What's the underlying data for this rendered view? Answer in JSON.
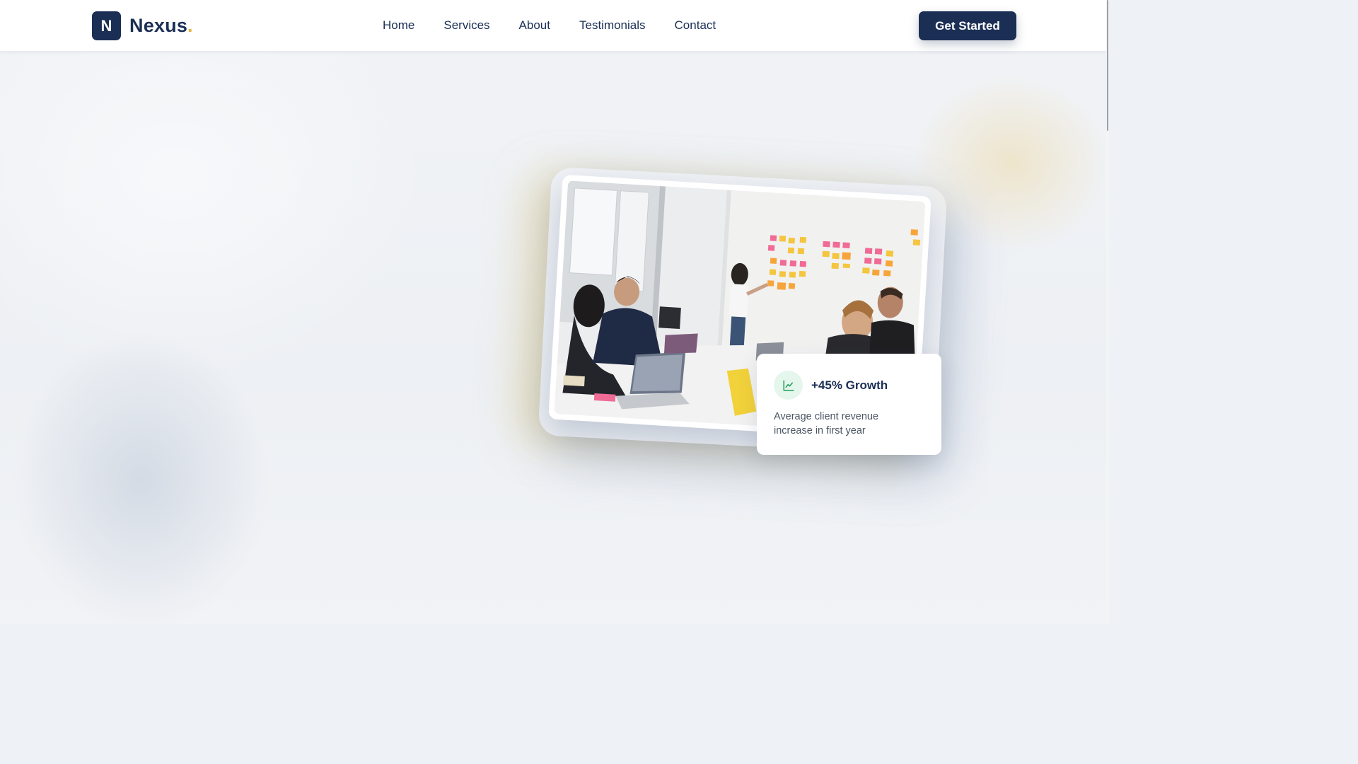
{
  "brand": {
    "mark": "N",
    "name": "Nexus",
    "dot": ".",
    "primary_color": "#1b2f55",
    "accent_color": "#e2b340"
  },
  "nav": {
    "links": [
      {
        "label": "Home"
      },
      {
        "label": "Services"
      },
      {
        "label": "About"
      },
      {
        "label": "Testimonials"
      },
      {
        "label": "Contact"
      }
    ],
    "cta_label": "Get Started"
  },
  "hero": {
    "image_subject": "team-meeting-photo",
    "stat": {
      "icon": "trending-up-icon",
      "title": "+45% Growth",
      "description": "Average client revenue increase in first year",
      "icon_color": "#1f9d55"
    }
  }
}
